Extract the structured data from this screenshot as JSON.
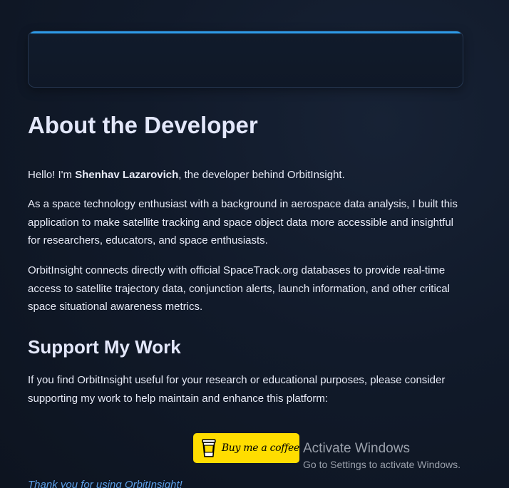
{
  "about": {
    "heading": "About the Developer",
    "intro_prefix": "Hello! I'm ",
    "developer_name": "Shenhav Lazarovich",
    "intro_suffix": ", the developer behind OrbitInsight.",
    "paragraph2": "As a space technology enthusiast with a background in aerospace data analysis, I built this application to make satellite tracking and space object data more accessible and insightful for researchers, educators, and space enthusiasts.",
    "paragraph3": "OrbitInsight connects directly with official SpaceTrack.org databases to provide real-time access to satellite trajectory data, conjunction alerts, launch information, and other critical space situational awareness metrics."
  },
  "support": {
    "heading": "Support My Work",
    "text": "If you find OrbitInsight useful for your research or educational purposes, please consider supporting my work to help maintain and enhance this platform:",
    "button_label": "Buy me a coffee",
    "button_color": "#ffdd00"
  },
  "footer": {
    "thanks": "Thank you for using OrbitInsight!"
  },
  "watermark": {
    "title": "Activate Windows",
    "subtitle": "Go to Settings to activate Windows."
  },
  "colors": {
    "background": "#101826",
    "accent_line": "#2e9be8",
    "link": "#5c9ee6"
  }
}
